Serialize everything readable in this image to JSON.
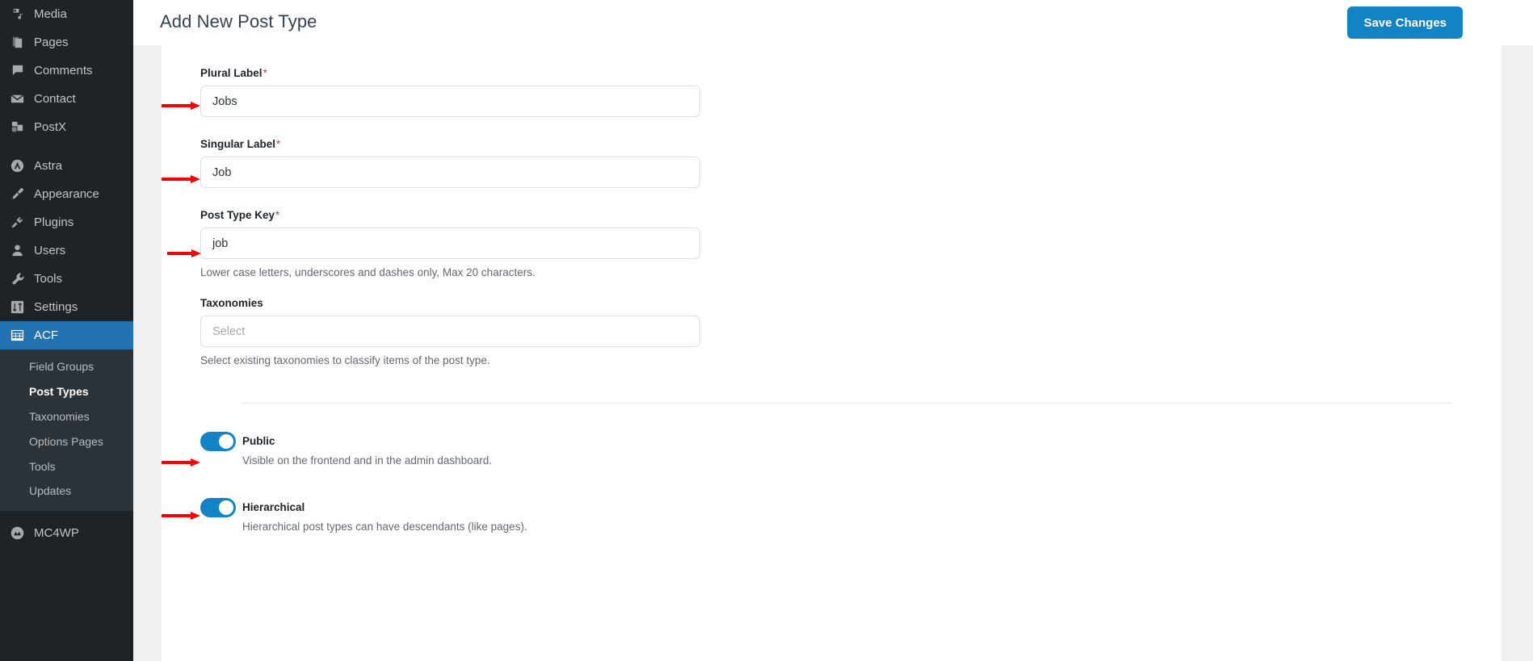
{
  "sidebar": {
    "items": [
      {
        "label": "Media",
        "icon": "media-icon"
      },
      {
        "label": "Pages",
        "icon": "pages-icon"
      },
      {
        "label": "Comments",
        "icon": "comments-icon"
      },
      {
        "label": "Contact",
        "icon": "contact-mail-icon"
      },
      {
        "label": "PostX",
        "icon": "postx-icon"
      },
      {
        "label": "Astra",
        "icon": "astra-icon"
      },
      {
        "label": "Appearance",
        "icon": "appearance-brush-icon"
      },
      {
        "label": "Plugins",
        "icon": "plugins-plug-icon"
      },
      {
        "label": "Users",
        "icon": "users-icon"
      },
      {
        "label": "Tools",
        "icon": "tools-wrench-icon"
      },
      {
        "label": "Settings",
        "icon": "settings-sliders-icon"
      },
      {
        "label": "ACF",
        "icon": "acf-grid-icon"
      }
    ],
    "active_label": "ACF",
    "submenu": [
      {
        "label": "Field Groups",
        "current": false
      },
      {
        "label": "Post Types",
        "current": true
      },
      {
        "label": "Taxonomies",
        "current": false
      },
      {
        "label": "Options Pages",
        "current": false
      },
      {
        "label": "Tools",
        "current": false
      },
      {
        "label": "Updates",
        "current": false
      }
    ],
    "footer_item": {
      "label": "MC4WP",
      "icon": "mc4wp-icon"
    }
  },
  "header": {
    "title": "Add New Post Type",
    "save_label": "Save Changes"
  },
  "colors": {
    "accent": "#1283c4",
    "sidebar_active": "#2271b1",
    "sidebar_bg": "#1d2327",
    "required": "#d63638",
    "arrow": "#f60000"
  },
  "form": {
    "fields": [
      {
        "label": "Plural Label",
        "required": "*",
        "value": "Jobs",
        "placeholder": "",
        "help": ""
      },
      {
        "label": "Singular Label",
        "required": "*",
        "value": "Job",
        "placeholder": "",
        "help": ""
      },
      {
        "label": "Post Type Key",
        "required": "*",
        "value": "job",
        "placeholder": "",
        "help": "Lower case letters, underscores and dashes only, Max 20 characters."
      },
      {
        "label": "Taxonomies",
        "required": "",
        "value": "",
        "placeholder": "Select",
        "help": "Select existing taxonomies to classify items of the post type."
      }
    ],
    "toggles": [
      {
        "title": "Public",
        "description": "Visible on the frontend and in the admin dashboard.",
        "state": "on"
      },
      {
        "title": "Hierarchical",
        "description": "Hierarchical post types can have descendants (like pages).",
        "state": "on"
      }
    ]
  }
}
